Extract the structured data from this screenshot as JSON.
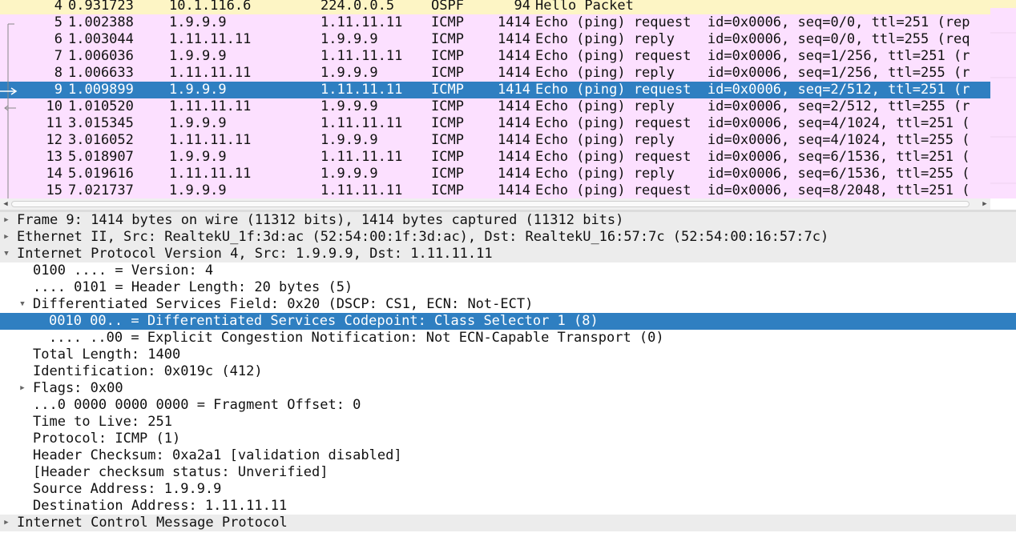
{
  "packet_list": {
    "rows": [
      {
        "no": "4",
        "time": "0.931723",
        "source": "10.1.116.6",
        "destination": "224.0.0.5",
        "protocol": "OSPF",
        "length": "94",
        "info": "Hello Packet",
        "kind": "ospf"
      },
      {
        "no": "5",
        "time": "1.002388",
        "source": "1.9.9.9",
        "destination": "1.11.11.11",
        "protocol": "ICMP",
        "length": "1414",
        "info": "Echo (ping) request  id=0x0006, seq=0/0, ttl=251 (rep",
        "kind": "icmp"
      },
      {
        "no": "6",
        "time": "1.003044",
        "source": "1.11.11.11",
        "destination": "1.9.9.9",
        "protocol": "ICMP",
        "length": "1414",
        "info": "Echo (ping) reply    id=0x0006, seq=0/0, ttl=255 (req",
        "kind": "icmp"
      },
      {
        "no": "7",
        "time": "1.006036",
        "source": "1.9.9.9",
        "destination": "1.11.11.11",
        "protocol": "ICMP",
        "length": "1414",
        "info": "Echo (ping) request  id=0x0006, seq=1/256, ttl=251 (r",
        "kind": "icmp"
      },
      {
        "no": "8",
        "time": "1.006633",
        "source": "1.11.11.11",
        "destination": "1.9.9.9",
        "protocol": "ICMP",
        "length": "1414",
        "info": "Echo (ping) reply    id=0x0006, seq=1/256, ttl=255 (r",
        "kind": "icmp"
      },
      {
        "no": "9",
        "time": "1.009899",
        "source": "1.9.9.9",
        "destination": "1.11.11.11",
        "protocol": "ICMP",
        "length": "1414",
        "info": "Echo (ping) request  id=0x0006, seq=2/512, ttl=251 (r",
        "kind": "selected"
      },
      {
        "no": "10",
        "time": "1.010520",
        "source": "1.11.11.11",
        "destination": "1.9.9.9",
        "protocol": "ICMP",
        "length": "1414",
        "info": "Echo (ping) reply    id=0x0006, seq=2/512, ttl=255 (r",
        "kind": "icmp"
      },
      {
        "no": "11",
        "time": "3.015345",
        "source": "1.9.9.9",
        "destination": "1.11.11.11",
        "protocol": "ICMP",
        "length": "1414",
        "info": "Echo (ping) request  id=0x0006, seq=4/1024, ttl=251 (",
        "kind": "icmp"
      },
      {
        "no": "12",
        "time": "3.016052",
        "source": "1.11.11.11",
        "destination": "1.9.9.9",
        "protocol": "ICMP",
        "length": "1414",
        "info": "Echo (ping) reply    id=0x0006, seq=4/1024, ttl=255 (",
        "kind": "icmp"
      },
      {
        "no": "13",
        "time": "5.018907",
        "source": "1.9.9.9",
        "destination": "1.11.11.11",
        "protocol": "ICMP",
        "length": "1414",
        "info": "Echo (ping) request  id=0x0006, seq=6/1536, ttl=251 (",
        "kind": "icmp"
      },
      {
        "no": "14",
        "time": "5.019616",
        "source": "1.11.11.11",
        "destination": "1.9.9.9",
        "protocol": "ICMP",
        "length": "1414",
        "info": "Echo (ping) reply    id=0x0006, seq=6/1536, ttl=255 (",
        "kind": "icmp"
      },
      {
        "no": "15",
        "time": "7.021737",
        "source": "1.9.9.9",
        "destination": "1.11.11.11",
        "protocol": "ICMP",
        "length": "1414",
        "info": "Echo (ping) request  id=0x0006, seq=8/2048, ttl=251 (",
        "kind": "icmp"
      }
    ]
  },
  "details": [
    {
      "id": "frame",
      "text": "Frame 9: 1414 bytes on wire (11312 bits), 1414 bytes captured (11312 bits)",
      "level": 0,
      "state": "collapsed",
      "section": true
    },
    {
      "id": "ethernet",
      "text": "Ethernet II, Src: RealtekU_1f:3d:ac (52:54:00:1f:3d:ac), Dst: RealtekU_16:57:7c (52:54:00:16:57:7c)",
      "level": 0,
      "state": "collapsed",
      "section": true
    },
    {
      "id": "ipv4",
      "text": "Internet Protocol Version 4, Src: 1.9.9.9, Dst: 1.11.11.11",
      "level": 0,
      "state": "expanded",
      "section": true
    },
    {
      "id": "version",
      "text": "0100 .... = Version: 4",
      "level": 1,
      "state": "leaf"
    },
    {
      "id": "header-length",
      "text": ".... 0101 = Header Length: 20 bytes (5)",
      "level": 1,
      "state": "leaf"
    },
    {
      "id": "dsfield",
      "text": "Differentiated Services Field: 0x20 (DSCP: CS1, ECN: Not-ECT)",
      "level": 1,
      "state": "expanded"
    },
    {
      "id": "dscp",
      "text": "0010 00.. = Differentiated Services Codepoint: Class Selector 1 (8)",
      "level": 2,
      "state": "leaf",
      "selected": true
    },
    {
      "id": "ecn",
      "text": ".... ..00 = Explicit Congestion Notification: Not ECN-Capable Transport (0)",
      "level": 2,
      "state": "leaf"
    },
    {
      "id": "total-length",
      "text": "Total Length: 1400",
      "level": 1,
      "state": "leaf"
    },
    {
      "id": "identification",
      "text": "Identification: 0x019c (412)",
      "level": 1,
      "state": "leaf"
    },
    {
      "id": "flags",
      "text": "Flags: 0x00",
      "level": 1,
      "state": "collapsed"
    },
    {
      "id": "fragment-offset",
      "text": "...0 0000 0000 0000 = Fragment Offset: 0",
      "level": 1,
      "state": "leaf"
    },
    {
      "id": "ttl",
      "text": "Time to Live: 251",
      "level": 1,
      "state": "leaf"
    },
    {
      "id": "protocol",
      "text": "Protocol: ICMP (1)",
      "level": 1,
      "state": "leaf"
    },
    {
      "id": "checksum",
      "text": "Header Checksum: 0xa2a1 [validation disabled]",
      "level": 1,
      "state": "leaf"
    },
    {
      "id": "checksum-status",
      "text": "[Header checksum status: Unverified]",
      "level": 1,
      "state": "leaf"
    },
    {
      "id": "src-addr",
      "text": "Source Address: 1.9.9.9",
      "level": 1,
      "state": "leaf"
    },
    {
      "id": "dst-addr",
      "text": "Destination Address: 1.11.11.11",
      "level": 1,
      "state": "leaf"
    },
    {
      "id": "icmp",
      "text": "Internet Control Message Protocol",
      "level": 0,
      "state": "collapsed",
      "section": true
    }
  ],
  "icons": {
    "collapsed": "triangle-right-icon",
    "expanded": "triangle-down-icon"
  },
  "colors": {
    "selected": "#2f7fc1",
    "icmp_row": "#fce0ff",
    "ospf_row": "#fdf5c5",
    "section_row": "#ececec"
  }
}
